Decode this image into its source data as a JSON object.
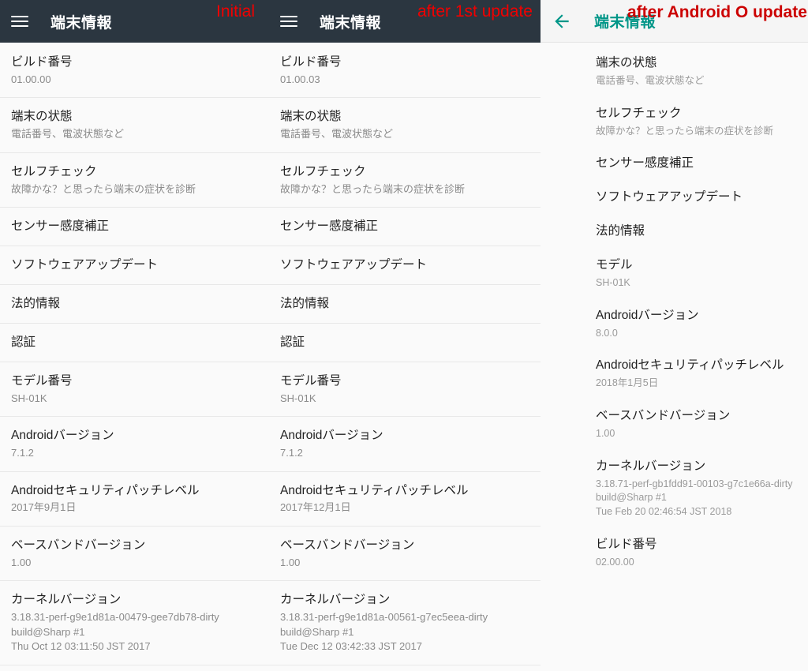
{
  "panels": [
    {
      "id": "initial",
      "annotation": "Initial",
      "appbar": {
        "icon": "hamburger-icon",
        "title": "端末情報"
      },
      "items": [
        {
          "title": "ビルド番号",
          "sub": [
            "01.00.00"
          ]
        },
        {
          "title": "端末の状態",
          "sub": [
            "電話番号、電波状態など"
          ]
        },
        {
          "title": "セルフチェック",
          "sub": [
            "故障かな？と思ったら端末の症状を診断"
          ]
        },
        {
          "title": "センサー感度補正",
          "sub": []
        },
        {
          "title": "ソフトウェアアップデート",
          "sub": []
        },
        {
          "title": "法的情報",
          "sub": []
        },
        {
          "title": "認証",
          "sub": []
        },
        {
          "title": "モデル番号",
          "sub": [
            "SH-01K"
          ]
        },
        {
          "title": "Androidバージョン",
          "sub": [
            "7.1.2"
          ]
        },
        {
          "title": "Androidセキュリティパッチレベル",
          "sub": [
            "2017年9月1日"
          ]
        },
        {
          "title": "ベースバンドバージョン",
          "sub": [
            "1.00"
          ]
        },
        {
          "title": "カーネルバージョン",
          "sub": [
            "3.18.31-perf-g9e1d81a-00479-gee7db78-dirty",
            "build@Sharp #1",
            "Thu Oct 12 03:11:50 JST 2017"
          ]
        }
      ]
    },
    {
      "id": "after-1st-update",
      "annotation": "after 1st update",
      "appbar": {
        "icon": "hamburger-icon",
        "title": "端末情報"
      },
      "items": [
        {
          "title": "ビルド番号",
          "sub": [
            "01.00.03"
          ]
        },
        {
          "title": "端末の状態",
          "sub": [
            "電話番号、電波状態など"
          ]
        },
        {
          "title": "セルフチェック",
          "sub": [
            "故障かな？と思ったら端末の症状を診断"
          ]
        },
        {
          "title": "センサー感度補正",
          "sub": []
        },
        {
          "title": "ソフトウェアアップデート",
          "sub": []
        },
        {
          "title": "法的情報",
          "sub": []
        },
        {
          "title": "認証",
          "sub": []
        },
        {
          "title": "モデル番号",
          "sub": [
            "SH-01K"
          ]
        },
        {
          "title": "Androidバージョン",
          "sub": [
            "7.1.2"
          ]
        },
        {
          "title": "Androidセキュリティパッチレベル",
          "sub": [
            "2017年12月1日"
          ]
        },
        {
          "title": "ベースバンドバージョン",
          "sub": [
            "1.00"
          ]
        },
        {
          "title": "カーネルバージョン",
          "sub": [
            "3.18.31-perf-g9e1d81a-00561-g7ec5eea-dirty",
            "build@Sharp #1",
            "Tue Dec 12 03:42:33 JST 2017"
          ]
        }
      ]
    },
    {
      "id": "after-android-o-update",
      "annotation": "after Android O update",
      "appbar": {
        "icon": "back-arrow-icon",
        "title": "端末情報"
      },
      "items": [
        {
          "title": "端末の状態",
          "sub": [
            "電話番号、電波状態など"
          ]
        },
        {
          "title": "セルフチェック",
          "sub": [
            "故障かな？と思ったら端末の症状を診断"
          ]
        },
        {
          "title": "センサー感度補正",
          "sub": []
        },
        {
          "title": "ソフトウェアアップデート",
          "sub": []
        },
        {
          "title": "法的情報",
          "sub": []
        },
        {
          "title": "モデル",
          "sub": [
            "SH-01K"
          ]
        },
        {
          "title": "Androidバージョン",
          "sub": [
            "8.0.0"
          ]
        },
        {
          "title": "Androidセキュリティパッチレベル",
          "sub": [
            "2018年1月5日"
          ]
        },
        {
          "title": "ベースバンドバージョン",
          "sub": [
            "1.00"
          ]
        },
        {
          "title": "カーネルバージョン",
          "sub": [
            "3.18.71-perf-gb1fdd91-00103-g7c1e66a-dirty",
            "build@Sharp #1",
            "Tue Feb 20 02:46:54 JST 2018"
          ]
        },
        {
          "title": "ビルド番号",
          "sub": [
            "02.00.00"
          ]
        }
      ]
    }
  ],
  "colors": {
    "appbar_dark": "#2b3640",
    "appbar_light": "#f5f5f5",
    "accent_teal": "#009688",
    "annotation_red": "#f00000",
    "list_bg": "#fafafa",
    "divider": "#e8e8e8"
  }
}
